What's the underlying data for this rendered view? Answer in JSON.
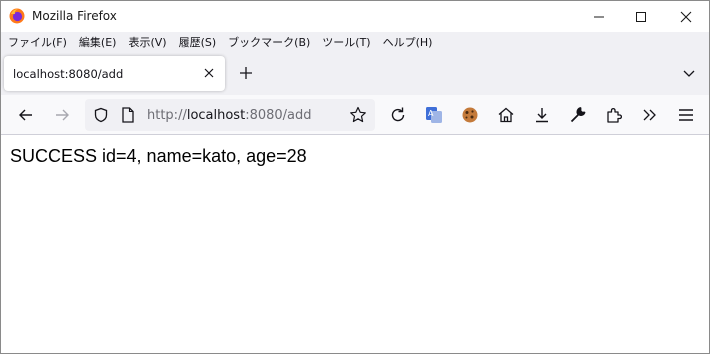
{
  "window": {
    "title": "Mozilla Firefox"
  },
  "menu": {
    "items": [
      "ファイル(F)",
      "編集(E)",
      "表示(V)",
      "履歴(S)",
      "ブックマーク(B)",
      "ツール(T)",
      "ヘルプ(H)"
    ]
  },
  "tabs": [
    {
      "label": "localhost:8080/add",
      "active": true
    }
  ],
  "address": {
    "scheme": "http://",
    "host": "localhost",
    "rest": ":8080/add"
  },
  "toolbar_icons": [
    "back-icon",
    "forward-icon",
    "shield-icon",
    "page-icon",
    "bookmark-star-icon",
    "reload-icon",
    "translate-icon",
    "cookie-icon",
    "home-icon",
    "download-icon",
    "wrench-icon",
    "extensions-icon",
    "overflow-icon",
    "menu-icon"
  ],
  "page": {
    "result_text": "SUCCESS id=4, name=kato, age=28"
  },
  "colors": {
    "chrome": "#f0f0f4",
    "navbar": "#f9f9fb",
    "translate_blue": "#3f6fd8"
  }
}
